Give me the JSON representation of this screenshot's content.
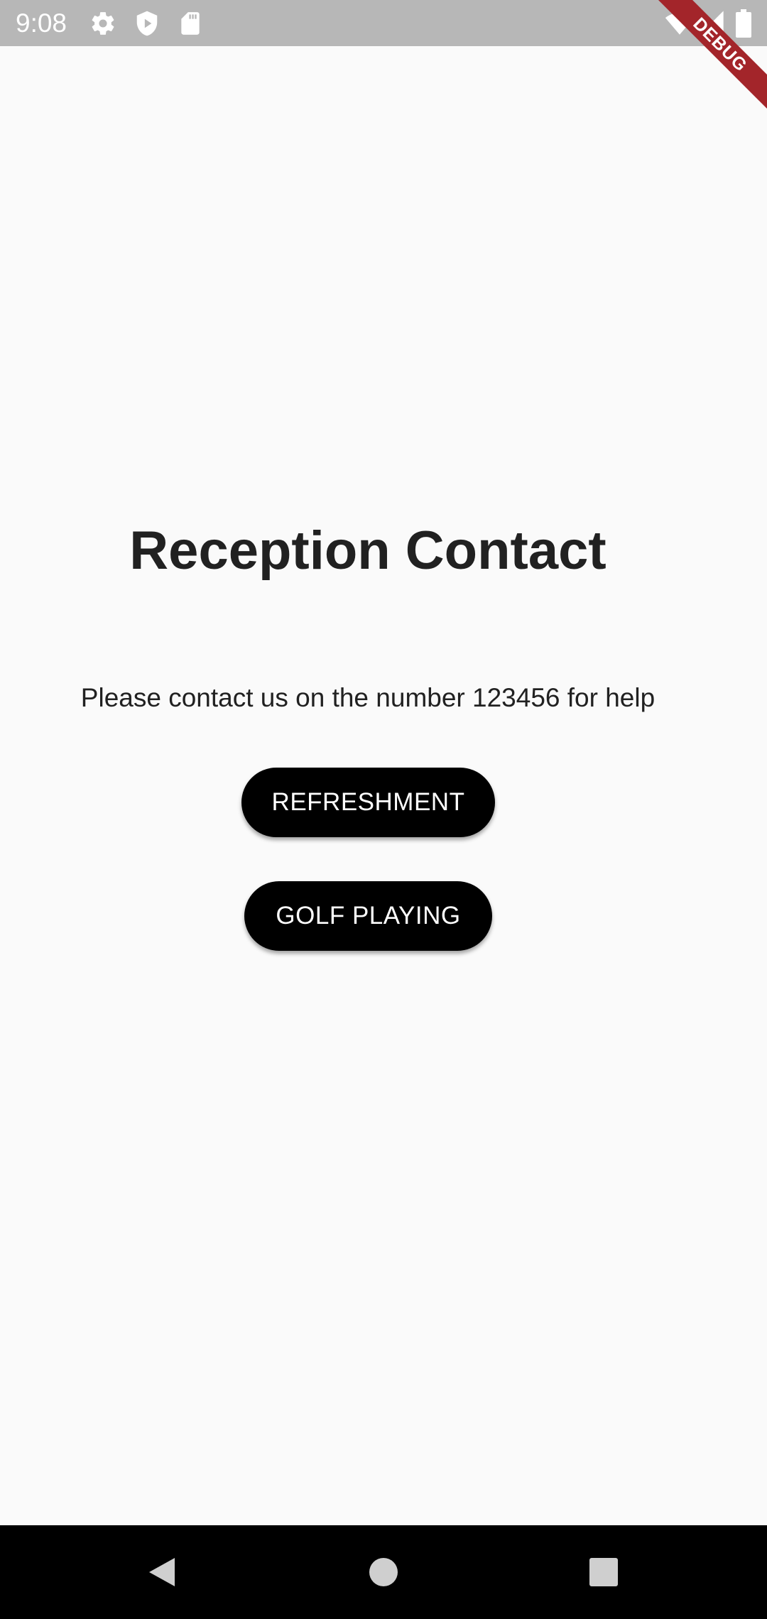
{
  "status_bar": {
    "time": "9:08",
    "icons_left": [
      "settings-icon",
      "shield-play-icon",
      "sd-card-icon"
    ],
    "icons_right": [
      "wifi-icon",
      "cell-signal-icon",
      "battery-icon"
    ]
  },
  "debug_banner": {
    "label": "DEBUG",
    "color": "#a3252a"
  },
  "main": {
    "title": "Reception Contact",
    "message": "Please contact us on the number 123456 for help",
    "buttons": [
      {
        "label": "REFRESHMENT"
      },
      {
        "label": "GOLF PLAYING"
      }
    ]
  },
  "nav_bar": {
    "buttons": [
      "back-icon",
      "home-icon",
      "recents-icon"
    ]
  },
  "colors": {
    "background": "#fafafa",
    "status_bar": "#b7b7b7",
    "button_bg": "#000000",
    "button_text": "#ffffff",
    "text": "#212121"
  }
}
